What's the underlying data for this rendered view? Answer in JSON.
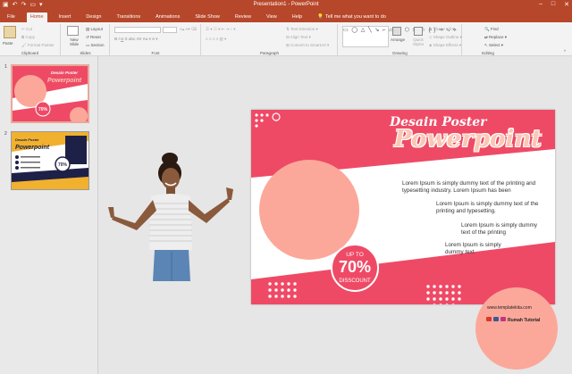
{
  "window": {
    "title": "Presentation1  -  PowerPoint"
  },
  "tabs": [
    {
      "label": "File",
      "active": false
    },
    {
      "label": "Home",
      "active": true
    },
    {
      "label": "Insert",
      "active": false
    },
    {
      "label": "Design",
      "active": false
    },
    {
      "label": "Transitions",
      "active": false
    },
    {
      "label": "Animations",
      "active": false
    },
    {
      "label": "Slide Show",
      "active": false
    },
    {
      "label": "Review",
      "active": false
    },
    {
      "label": "View",
      "active": false
    },
    {
      "label": "Help",
      "active": false
    }
  ],
  "tell_me": "Tell me what you want to do",
  "ribbon": {
    "clipboard": {
      "paste": "Paste",
      "cut": "Cut",
      "copy": "Copy",
      "format_painter": "Format Painter",
      "label": "Clipboard"
    },
    "slides": {
      "new_slide": "New Slide",
      "layout": "Layout",
      "reset": "Reset",
      "section": "Section",
      "label": "Slides"
    },
    "font": {
      "label": "Font"
    },
    "paragraph": {
      "text_direction": "Text Direction",
      "align_text": "Align Text",
      "convert": "Convert to SmartArt",
      "label": "Paragraph"
    },
    "drawing": {
      "arrange": "Arrange",
      "quick_styles": "Quick Styles",
      "shape_fill": "Shape Fill",
      "shape_outline": "Shape Outline",
      "shape_effects": "Shape Effects",
      "label": "Drawing"
    },
    "editing": {
      "find": "Find",
      "replace": "Replace",
      "select": "Select",
      "label": "Editing"
    }
  },
  "thumbnails": [
    {
      "number": "1",
      "selected": true
    },
    {
      "number": "2",
      "selected": false
    }
  ],
  "slide": {
    "title_line1": "Desain Poster",
    "title_line2": "Powerpoint",
    "text1": "Lorem Ipsum is simply dummy text of the printing and typesetting industry. Lorem Ipsum has been",
    "text2": "Lorem Ipsum is simply dummy text of the printing and typesetting.",
    "text3": "Lorem Ipsum is simply dummy text of the printing",
    "text4": "Lorem Ipsum is simply dummy text",
    "badge_up": "UP TO",
    "badge_value": "70%",
    "badge_label": "DISSCOUNT",
    "website": "www.templatekita.com",
    "brand": "Rumah Tutorial"
  },
  "colors": {
    "accent": "#b7472a",
    "pink": "#ee4a66",
    "salmon": "#fba89a"
  }
}
